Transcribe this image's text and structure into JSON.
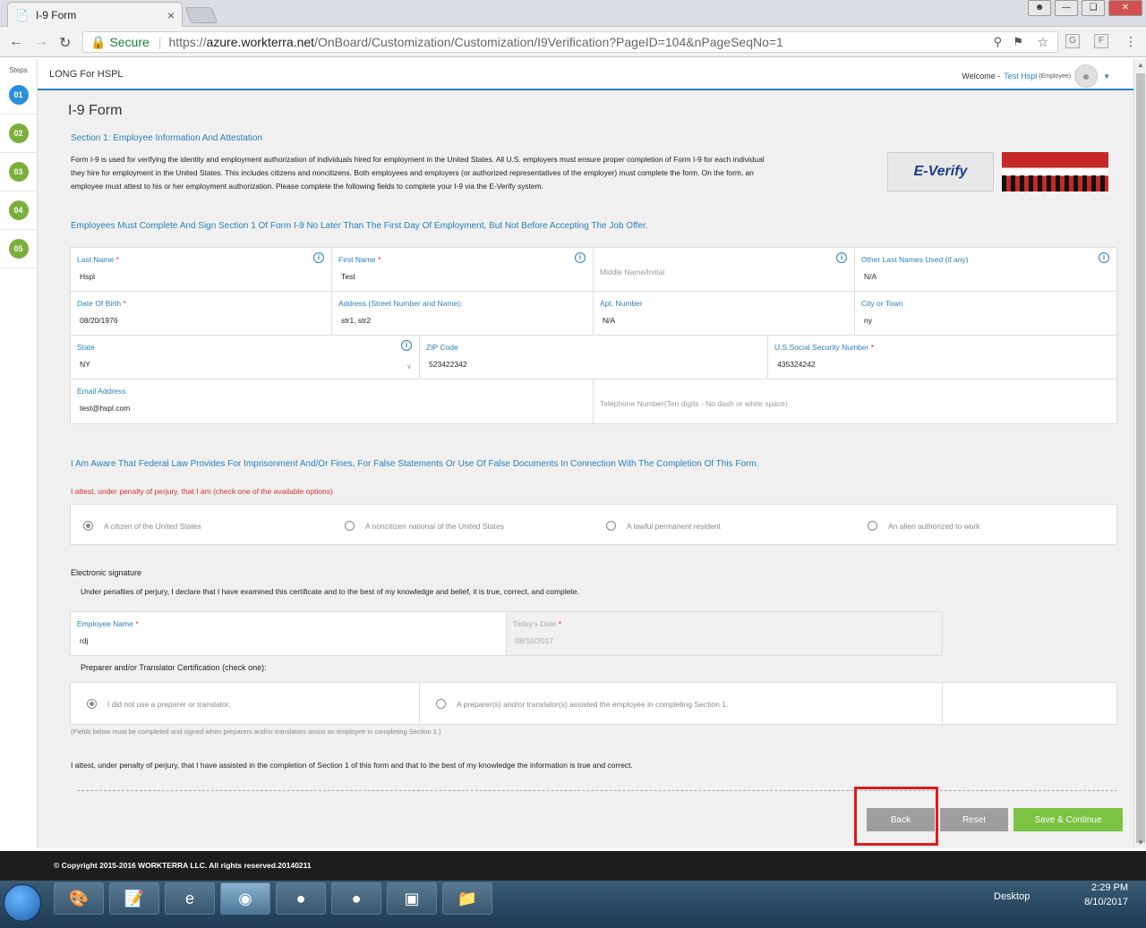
{
  "browser": {
    "tab_title": "I-9 Form",
    "tab_close": "×",
    "secure_label": "Secure",
    "url_scheme": "https://",
    "url_host": "azure.workterra.net",
    "url_path": "/OnBoard/Customization/Customization/I9Verification?PageID=104&nPageSeqNo=1"
  },
  "steps": {
    "label": "Steps",
    "items": [
      "01",
      "02",
      "03",
      "04",
      "05"
    ]
  },
  "header": {
    "company": "LONG For HSPL",
    "welcome": "Welcome -",
    "user_name": "Test Hspl",
    "user_role": "(Employee)"
  },
  "page": {
    "title": "I-9 Form",
    "section_title": "Section 1: Employee Information And Attestation",
    "intro": "Form I-9 is used for verifying the identity and employment authorization of individuals hired for employment in the United States. All U.S. employers must ensure proper completion of Form I-9 for each individual they hire for employment in the United States. This includes citizens and noncitizens. Both employees and employers (or authorized representatives of the employer) must complete the form. On the form, an employee must attest to his or her employment authorization. Please complete the following fields to complete your I-9 via the E-Verify system.",
    "everify_logo": "E-Verify",
    "emphasis": "Employees Must Complete And Sign Section 1 Of Form I-9 No Later Than The First Day Of Employment, But Not Before Accepting The Job Offer."
  },
  "fields": {
    "last_name": {
      "label": "Last Name",
      "value": "Hspl"
    },
    "first_name": {
      "label": "First Name",
      "value": "Test"
    },
    "middle_name": {
      "placeholder": "Middle Name/Initial"
    },
    "other_last_names": {
      "label": "Other Last Names Used (if any)",
      "value": "N/A"
    },
    "dob": {
      "label": "Date Of Birth",
      "value": "08/20/1976"
    },
    "address": {
      "label": "Address (Street Number and Name):",
      "value": "str1, str2"
    },
    "apt": {
      "label": "Apt. Number",
      "value": "N/A"
    },
    "city": {
      "label": "City or Town",
      "value": "ny"
    },
    "state": {
      "label": "State",
      "value": "NY"
    },
    "zip": {
      "label": "ZIP Code",
      "value": "523422342"
    },
    "ssn": {
      "label": "U.S.Social Security Number",
      "value": "435324242"
    },
    "email": {
      "label": "Email Address",
      "value": "test@hspl.com"
    },
    "phone": {
      "placeholder": "Telephone Number(Ten digits - No dash or white space)"
    }
  },
  "attestation": {
    "aware": "I Am Aware That Federal Law Provides For Imprisonment And/Or Fines, For False Statements Or Use Of False Documents In Connection With The Completion Of This Form.",
    "instruction": "I attest, under penalty of perjury, that I am (check one of the available options)",
    "options": [
      "A citizen of the United States",
      "A noncitizen national of the United States",
      "A lawful permanent resident",
      "An alien authorized to work"
    ],
    "selected_index": 0
  },
  "signature": {
    "heading": "Electronic signature",
    "declaration": "Under penalties of perjury, I declare that I have examined this certificate and to the best of my knowledge and belief, it is true, correct, and complete.",
    "employee_name_label": "Employee Name",
    "employee_name_value": "rdj",
    "date_label": "Today's Date",
    "date_value": "08/10/2017"
  },
  "preparer": {
    "heading": "Preparer and/or Translator Certification (check one):",
    "options": [
      "I did not use a preparer or translator.",
      "A preparer(s) and/or translator(s) assisted the employee in completing Section 1."
    ],
    "note": "(Fields below must be completed and signed when preparers and/or translators assist an employee in completing Section 1.)",
    "final_attest": "I attest, under penalty of perjury, that I have assisted in the completion of Section 1 of this form and that to the best of my knowledge the information is true and correct."
  },
  "buttons": {
    "back": "Back",
    "reset": "Reset",
    "save": "Save & Continue"
  },
  "footer": {
    "copyright": "© Copyright 2015-2016 WORKTERRA LLC. All rights reserved.20140211"
  },
  "taskbar": {
    "desktop": "Desktop",
    "time": "2:29 PM",
    "date": "8/10/2017"
  },
  "colors": {
    "accent": "#2a7fb8",
    "required": "#d32f2f",
    "save_green": "#7cc243",
    "button_gray": "#9e9e9e",
    "highlight_red": "#e01919"
  }
}
